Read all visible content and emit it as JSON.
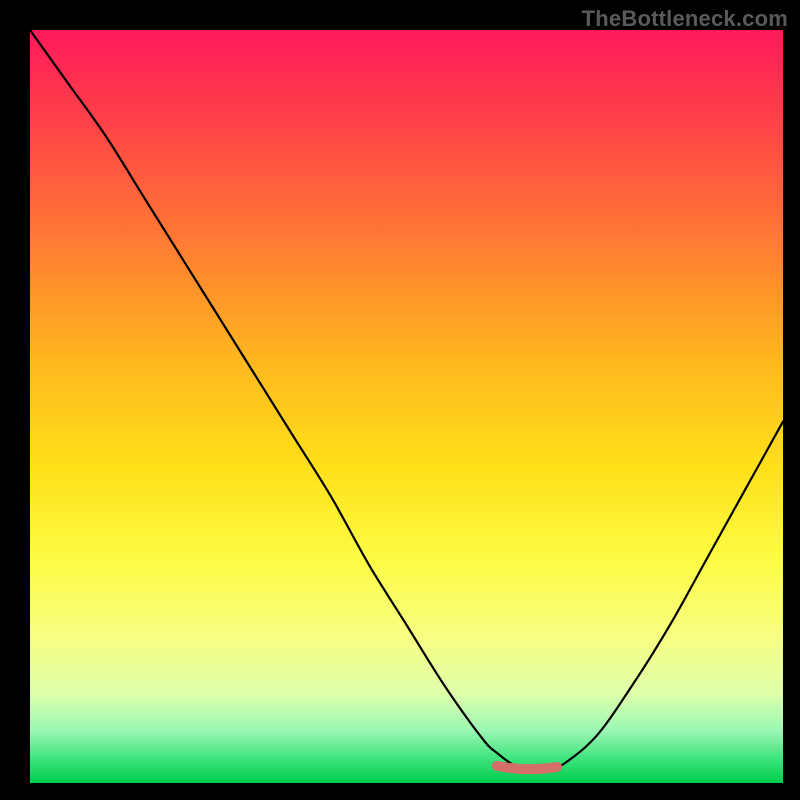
{
  "watermark": "TheBottleneck.com",
  "colors": {
    "curve_stroke": "#000000",
    "marker_stroke": "#d36e68",
    "frame_bg": "#000000"
  },
  "chart_data": {
    "type": "line",
    "title": "",
    "xlabel": "",
    "ylabel": "",
    "xlim": [
      0,
      100
    ],
    "ylim": [
      0,
      100
    ],
    "x": [
      0,
      5,
      10,
      15,
      20,
      25,
      30,
      35,
      40,
      45,
      50,
      55,
      60,
      62,
      65,
      68,
      70,
      75,
      80,
      85,
      90,
      95,
      100
    ],
    "values": [
      100,
      93,
      86,
      78,
      70,
      62,
      54,
      46,
      38,
      29,
      21,
      13,
      6,
      4,
      2,
      2,
      2,
      6,
      13,
      21,
      30,
      39,
      48
    ],
    "highlight": {
      "x_start": 62,
      "x_end": 70,
      "y": 2
    },
    "background_gradient": [
      "#ff1a5b",
      "#ffe019",
      "#00cc4a"
    ],
    "grid": false,
    "legend": false
  }
}
